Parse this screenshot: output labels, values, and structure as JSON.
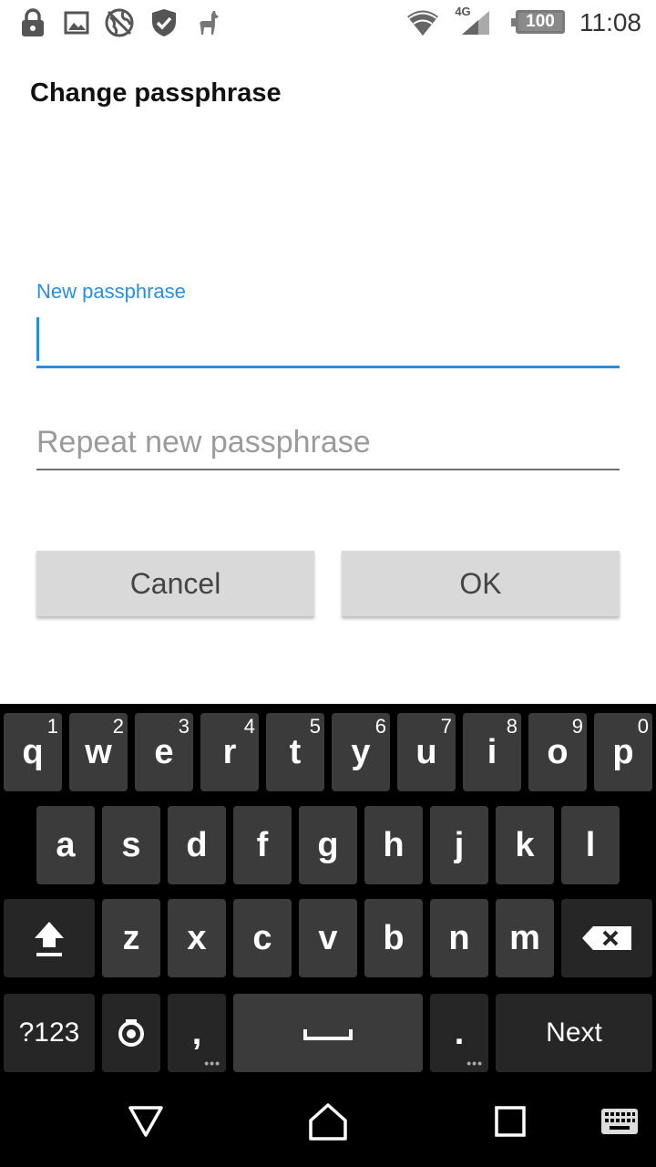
{
  "status_bar": {
    "time": "11:08",
    "battery": "100",
    "network": "4G",
    "left_icons": [
      "lock-icon",
      "image-icon",
      "globe-icon",
      "shield-check-icon",
      "llama-icon"
    ],
    "right_icons": [
      "wifi-icon",
      "signal-icon",
      "battery-icon"
    ]
  },
  "dialog": {
    "title": "Change passphrase",
    "new_passphrase_label": "New passphrase",
    "new_passphrase_value": "",
    "repeat_placeholder": "Repeat new passphrase",
    "repeat_value": "",
    "cancel_label": "Cancel",
    "ok_label": "OK"
  },
  "keyboard": {
    "row1": [
      {
        "key": "q",
        "hint": "1"
      },
      {
        "key": "w",
        "hint": "2"
      },
      {
        "key": "e",
        "hint": "3"
      },
      {
        "key": "r",
        "hint": "4"
      },
      {
        "key": "t",
        "hint": "5"
      },
      {
        "key": "y",
        "hint": "6"
      },
      {
        "key": "u",
        "hint": "7"
      },
      {
        "key": "i",
        "hint": "8"
      },
      {
        "key": "o",
        "hint": "9"
      },
      {
        "key": "p",
        "hint": "0"
      }
    ],
    "row2": [
      "a",
      "s",
      "d",
      "f",
      "g",
      "h",
      "j",
      "k",
      "l"
    ],
    "row3": [
      "z",
      "x",
      "c",
      "v",
      "b",
      "n",
      "m"
    ],
    "symbols_label": "?123",
    "comma": ",",
    "period": ".",
    "next_label": "Next",
    "accent": "#2a8ee0"
  },
  "navbar": {
    "icons": [
      "back-icon",
      "home-icon",
      "recents-icon",
      "keyboard-icon"
    ]
  }
}
